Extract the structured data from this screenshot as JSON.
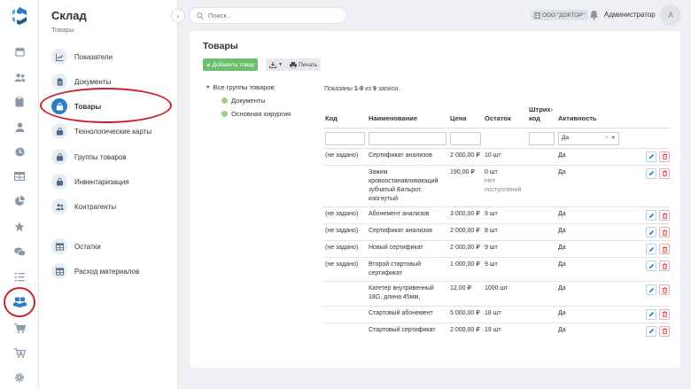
{
  "app": {
    "title": "Склад",
    "subtitle": "Товары"
  },
  "rail": {
    "icons": [
      "calendar-icon",
      "users-icon",
      "clipboard-icon",
      "person-icon",
      "clock-icon",
      "table-icon",
      "pie-chart-icon",
      "star-icon",
      "chat-icon",
      "list-check-icon",
      "storage-icon",
      "cart-icon",
      "cart-arrow-icon",
      "gear-icon"
    ],
    "active": "storage-icon"
  },
  "sidebar": {
    "items": [
      {
        "label": "Показатели",
        "icon": "chart-line-icon"
      },
      {
        "label": "Документы",
        "icon": "document-icon"
      },
      {
        "label": "Товары",
        "icon": "bag-icon",
        "active": true
      },
      {
        "label": "Технологические карты",
        "icon": "bag-icon"
      },
      {
        "label": "Группы товаров",
        "icon": "bag-icon"
      },
      {
        "label": "Инвентаризация",
        "icon": "bag-icon"
      },
      {
        "label": "Контрагенты",
        "icon": "users-icon"
      },
      {
        "label": "Остатки",
        "icon": "table-icon"
      },
      {
        "label": "Расход материалов",
        "icon": "table-icon"
      }
    ]
  },
  "header": {
    "search_placeholder": "Поиск...",
    "org": "ООО \"ДОКТОР\"",
    "user": "Администратор",
    "avatar": "А"
  },
  "page": {
    "title": "Товары",
    "add_button": "Добавить товар",
    "export_button": "",
    "print_button": "Печать",
    "tree_root": "Все группы товаров",
    "tree_children": [
      "Документы",
      "Основная хирургия"
    ],
    "summary_prefix": "Показаны ",
    "summary_range": "1-9",
    "summary_mid": " из ",
    "summary_total": "9",
    "summary_suffix": " записи.",
    "columns": [
      "Код",
      "Наименование",
      "Цена",
      "Остаток",
      "Штрих-код",
      "Активность"
    ],
    "filter_activity": "Да",
    "filter_clear": "×",
    "rows": [
      {
        "code": "(не задано)",
        "name": "Сертификат анализов",
        "price": "2 000,00 ₽",
        "stock": "10 шт",
        "stock_note": "",
        "barcode": "",
        "active": "Да"
      },
      {
        "code": "",
        "name": "Зажим кровоостанавливающий зубчатый Бильрот, изогнутый",
        "price": "190,00 ₽",
        "stock": "0 шт",
        "stock_note": "Нет поступлений",
        "barcode": "",
        "active": "Да"
      },
      {
        "code": "(не задано)",
        "name": "Абонемент анализов",
        "price": "3 000,00 ₽",
        "stock": "9 шт",
        "stock_note": "",
        "barcode": "",
        "active": "Да"
      },
      {
        "code": "(не задано)",
        "name": "Сертификат анализов",
        "price": "2 000,00 ₽",
        "stock": "8 шт",
        "stock_note": "",
        "barcode": "",
        "active": "Да"
      },
      {
        "code": "(не задано)",
        "name": "Новый сертификат",
        "price": "2 000,00 ₽",
        "stock": "9 шт",
        "stock_note": "",
        "barcode": "",
        "active": "Да"
      },
      {
        "code": "(не задано)",
        "name": "Второй стартовый сертификат",
        "price": "1 000,00 ₽",
        "stock": "9 шт",
        "stock_note": "",
        "barcode": "",
        "active": "Да"
      },
      {
        "code": "",
        "name": "Катетер внутривенный 18G, длина 45мм,",
        "price": "12,00 ₽",
        "stock": "1000 шт",
        "stock_note": "",
        "barcode": "",
        "active": "Да"
      },
      {
        "code": "",
        "name": "Стартовый абонемент",
        "price": "5 000,00 ₽",
        "stock": "18 шт",
        "stock_note": "",
        "barcode": "",
        "active": "Да"
      },
      {
        "code": "",
        "name": "Стартовый сертификат",
        "price": "2 000,00 ₽",
        "stock": "19 шт",
        "stock_note": "",
        "barcode": "",
        "active": "Да"
      }
    ]
  },
  "colors": {
    "primary": "#2c7fc4",
    "success": "#6bbf6d",
    "danger": "#d9534f",
    "highlight_ring": "#c8222b"
  }
}
